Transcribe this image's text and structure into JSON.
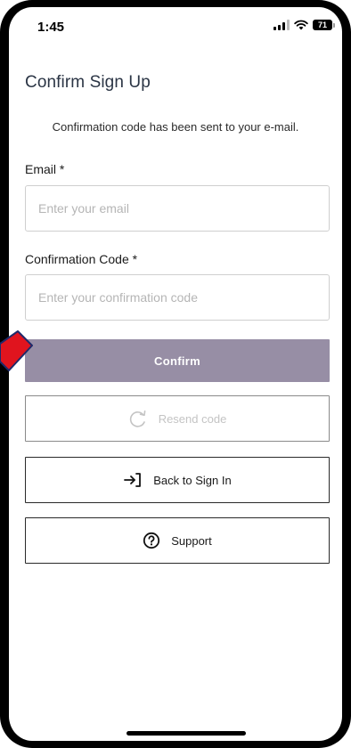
{
  "status_bar": {
    "time": "1:45",
    "battery_level": "71",
    "icons": [
      "signal-icon",
      "wifi-icon",
      "battery-icon"
    ]
  },
  "page": {
    "title": "Confirm Sign Up",
    "info": "Confirmation code has been sent to your e-mail."
  },
  "form": {
    "email_label": "Email *",
    "email_placeholder": "Enter your email",
    "email_value": "",
    "code_label": "Confirmation Code *",
    "code_placeholder": "Enter your confirmation code",
    "code_value": ""
  },
  "buttons": {
    "confirm": "Confirm",
    "resend": "Resend code",
    "back": "Back to Sign In",
    "support": "Support"
  },
  "colors": {
    "confirm_bg": "#978ea5",
    "title_text": "#2b3545",
    "annotation_arrow": "#e0141e"
  }
}
